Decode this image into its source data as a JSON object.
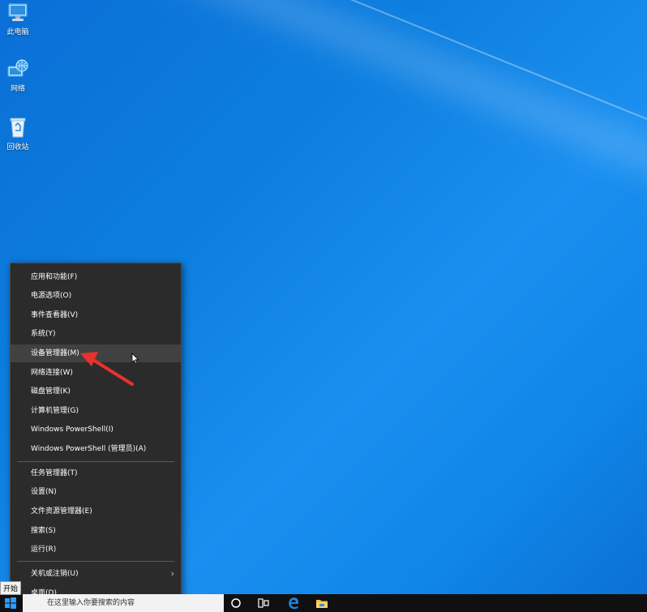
{
  "desktop": {
    "icons": [
      {
        "label": "此电脑",
        "icon": "computer-icon"
      },
      {
        "label": "网络",
        "icon": "network-icon"
      },
      {
        "label": "回收站",
        "icon": "recycle-bin-icon"
      }
    ]
  },
  "context_menu": {
    "items": [
      {
        "label": "应用和功能(F)"
      },
      {
        "label": "电源选项(O)"
      },
      {
        "label": "事件查看器(V)"
      },
      {
        "label": "系统(Y)"
      },
      {
        "label": "设备管理器(M)",
        "highlighted": true
      },
      {
        "label": "网络连接(W)"
      },
      {
        "label": "磁盘管理(K)"
      },
      {
        "label": "计算机管理(G)"
      },
      {
        "label": "Windows PowerShell(I)"
      },
      {
        "label": "Windows PowerShell (管理员)(A)"
      },
      {
        "label": "任务管理器(T)"
      },
      {
        "label": "设置(N)"
      },
      {
        "label": "文件资源管理器(E)"
      },
      {
        "label": "搜索(S)"
      },
      {
        "label": "运行(R)"
      },
      {
        "label": "关机或注销(U)",
        "has_submenu": true
      },
      {
        "label": "桌面(D)"
      }
    ]
  },
  "taskbar": {
    "search_placeholder": "在这里输入你要搜索的内容",
    "start_tooltip": "开始",
    "icons": [
      "start-icon",
      "cortana-icon",
      "task-view-icon",
      "edge-icon",
      "file-explorer-icon"
    ]
  },
  "colors": {
    "menu_bg": "#2b2b2b",
    "menu_hover": "#414141",
    "annotation_arrow": "#e8322c",
    "edge_blue": "#1e88e5"
  }
}
